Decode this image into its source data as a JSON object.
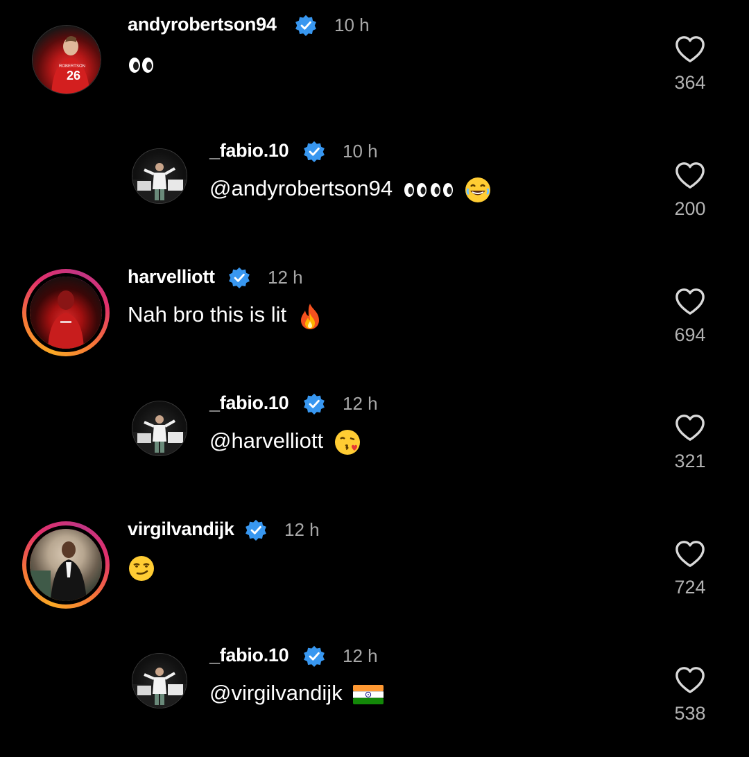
{
  "comments": [
    {
      "username": "andyrobertson94",
      "time": "10 h",
      "text": "",
      "emoji": "eyes",
      "likes": "364",
      "reply": false,
      "story": false
    },
    {
      "username": "_fabio.10",
      "time": "10 h",
      "text": "@andyrobertson94",
      "emoji": "eyes-x4-laugh",
      "likes": "200",
      "reply": true,
      "story": false
    },
    {
      "username": "harvelliott",
      "time": "12 h",
      "text": "Nah bro this is lit",
      "emoji": "fire",
      "likes": "694",
      "reply": false,
      "story": true
    },
    {
      "username": "_fabio.10",
      "time": "12 h",
      "text": "@harvelliott",
      "emoji": "kiss",
      "likes": "321",
      "reply": true,
      "story": false
    },
    {
      "username": "virgilvandijk",
      "time": "12 h",
      "text": "",
      "emoji": "smirk",
      "likes": "724",
      "reply": false,
      "story": true
    },
    {
      "username": "_fabio.10",
      "time": "12 h",
      "text": "@virgilvandijk",
      "emoji": "india-flag",
      "likes": "538",
      "reply": true,
      "story": false
    }
  ],
  "colors": {
    "background": "#000000",
    "text": "#ffffff",
    "muted": "#a8a8a8",
    "verified": "#3897f0"
  },
  "icons": {
    "verified": "verified-badge-icon",
    "like": "heart-outline-icon"
  }
}
